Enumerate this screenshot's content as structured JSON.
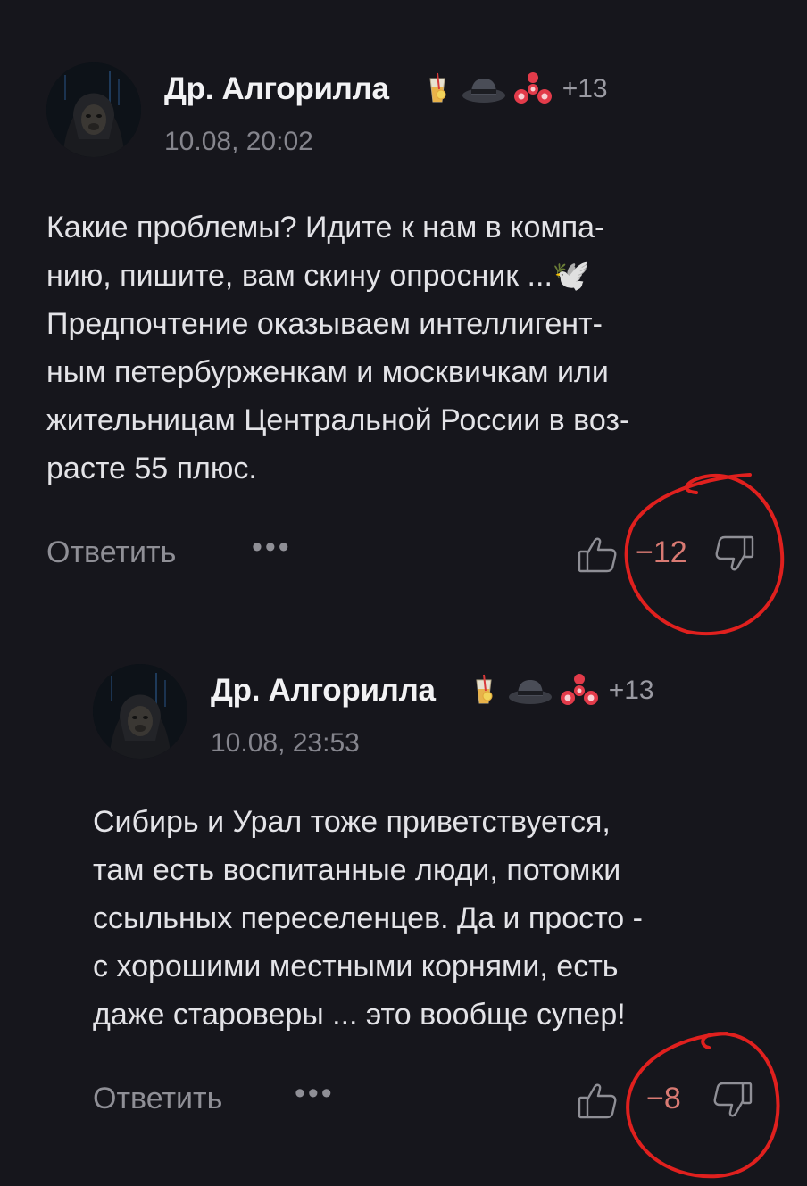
{
  "comments": [
    {
      "author": "Др. Алгорилла",
      "extra_badges": "+13",
      "time": "10.08, 20:02",
      "text": "Какие проблемы? Идите к нам в компа-\nнию, пишите, вам скину опросник ...🕊️\nПредпочтение оказываем интеллигент-\nным петербурженкам и москвичкам или\nжительницам Центральной России в воз-\nрасте 55 плюс.",
      "reply_label": "Ответить",
      "more_label": "•••",
      "score": "−12"
    },
    {
      "author": "Др. Алгорилла",
      "extra_badges": "+13",
      "time": "10.08, 23:53",
      "text": "Сибирь и Урал тоже приветствуется,\nтам есть воспитанные люди, потомки\nссыльных переселенцев. Да и просто -\nс хорошими местными корнями, есть\nдаже староверы ... это вообще супер!",
      "reply_label": "Ответить",
      "more_label": "•••",
      "score": "−8"
    }
  ],
  "badges": [
    "cocktail-icon",
    "hat-icon",
    "fidget-spinner-icon"
  ],
  "colors": {
    "background": "#16161c",
    "negative_score": "#d97a73",
    "annotation": "#e0201e"
  }
}
